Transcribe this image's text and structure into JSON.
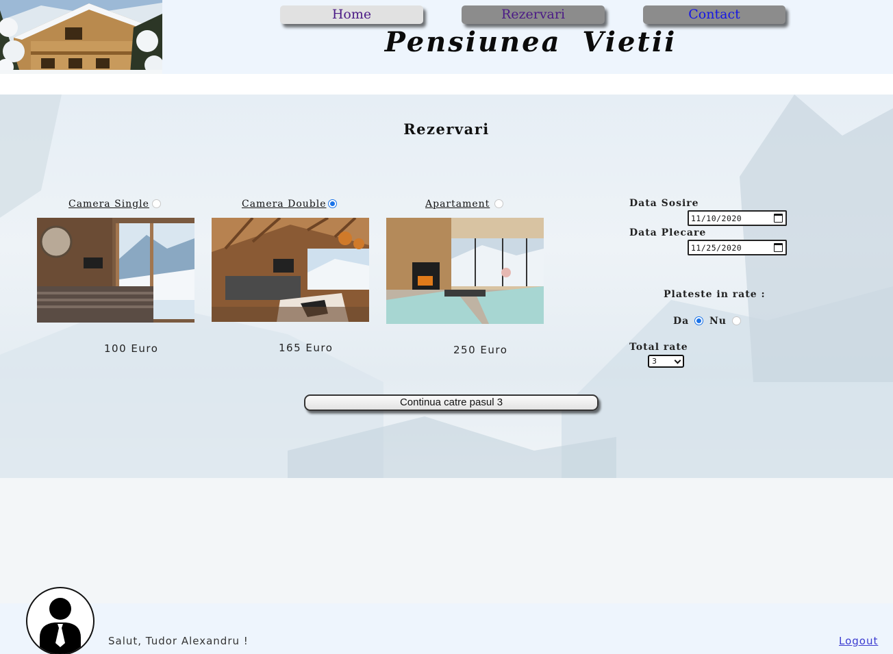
{
  "nav": {
    "home": "Home",
    "reservations": "Rezervari",
    "contact": "Contact"
  },
  "header": {
    "site_title": "Pensiunea Vietii",
    "logo_icon": "chalet-photo"
  },
  "page": {
    "heading": "Rezervari"
  },
  "rooms": [
    {
      "label": "Camera Single",
      "price": "100 Euro",
      "selected": false,
      "photo": "single-room-photo"
    },
    {
      "label": "Camera Double",
      "price": "165 Euro",
      "selected": true,
      "photo": "double-room-photo"
    },
    {
      "label": "Apartament",
      "price": "250 Euro",
      "selected": false,
      "photo": "apartment-photo"
    }
  ],
  "booking": {
    "arrival_label": "Data Sosire",
    "arrival_value": "11/10/2020",
    "departure_label": "Data Plecare",
    "departure_value": "11/25/2020",
    "installments_label": "Plateste in rate :",
    "yes_label": "Da",
    "no_label": "Nu",
    "installments_selected": "Da",
    "total_label": "Total rate",
    "total_value": "3"
  },
  "actions": {
    "continue_label": "Continua catre pasul 3"
  },
  "footer": {
    "greeting": "Salut, Tudor Alexandru !",
    "logout": "Logout",
    "avatar_icon": "user-avatar-icon"
  },
  "colors": {
    "header_bg": "#eef5fd",
    "nav_active": "#e1e1e1",
    "nav_inactive": "#8c8c8c",
    "nav_text": "#4b1a86",
    "contact_text": "#1515e6",
    "radio_accent": "#1a73e8"
  }
}
